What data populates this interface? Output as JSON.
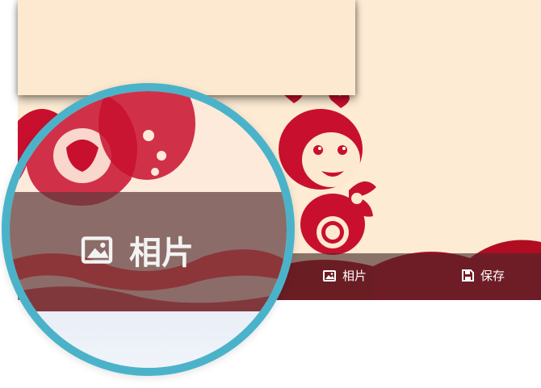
{
  "toolbar": {
    "photo_label": "相片",
    "save_label": "保存"
  },
  "magnifier": {
    "photo_label": "相片"
  },
  "colors": {
    "card_background": "#fdebd3",
    "toolbar_overlay": "#462828",
    "papercut_red": "#c8102e",
    "magnifier_border": "#4bb3c9"
  },
  "icons": {
    "photo": "image-icon",
    "save": "save-icon"
  }
}
